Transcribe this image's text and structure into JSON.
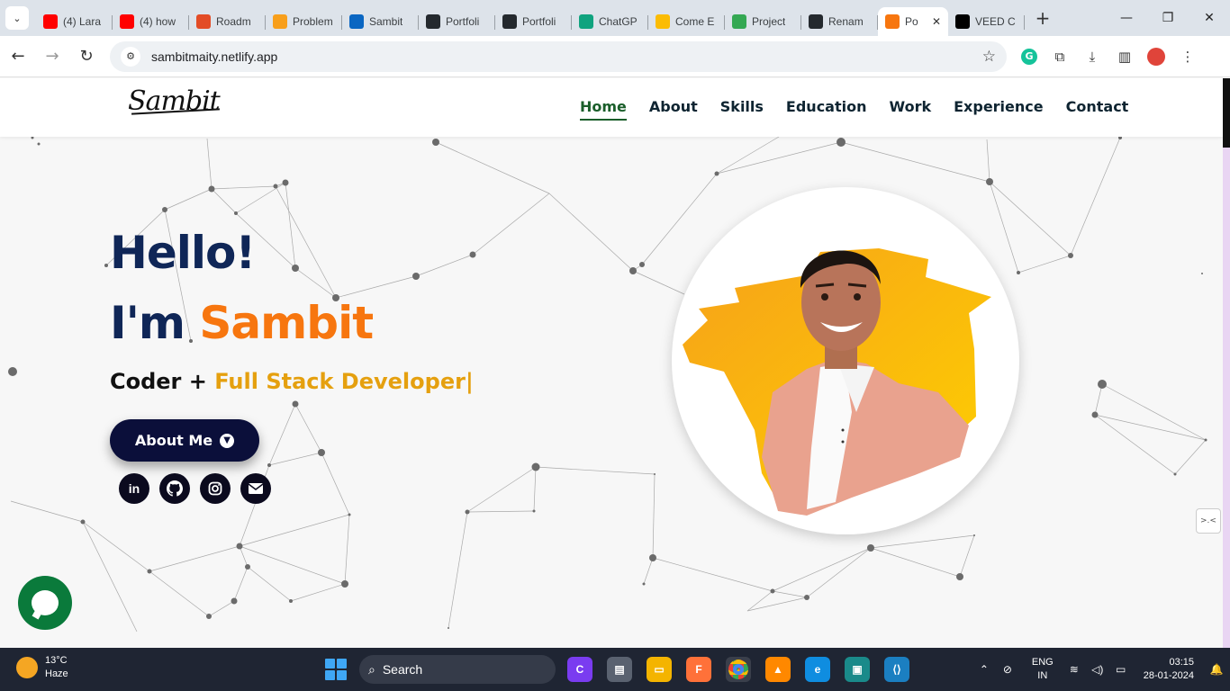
{
  "browser": {
    "tabs": [
      {
        "title": "(4) Lara",
        "icon": "youtube-icon",
        "color": "#ff0000"
      },
      {
        "title": "(4) how",
        "icon": "youtube-icon",
        "color": "#ff0000"
      },
      {
        "title": "Roadm",
        "icon": "rocket-icon",
        "color": "#e34c26"
      },
      {
        "title": "Problem",
        "icon": "leetcode-icon",
        "color": "#f89f1b"
      },
      {
        "title": "Sambit",
        "icon": "linkedin-icon",
        "color": "#0a66c2"
      },
      {
        "title": "Portfoli",
        "icon": "github-icon",
        "color": "#24292e"
      },
      {
        "title": "Portfoli",
        "icon": "github-icon",
        "color": "#24292e"
      },
      {
        "title": "ChatGP",
        "icon": "chatgpt-icon",
        "color": "#10a37f"
      },
      {
        "title": "Come E",
        "icon": "drive-icon",
        "color": "#fbbc04"
      },
      {
        "title": "Project",
        "icon": "drive-icon",
        "color": "#34a853"
      },
      {
        "title": "Renam",
        "icon": "github-icon",
        "color": "#24292e"
      },
      {
        "title": "Po",
        "icon": "portfolio-icon",
        "color": "#f7760f",
        "active": true
      },
      {
        "title": "VEED C",
        "icon": "veed-icon",
        "color": "#000000"
      }
    ],
    "url": "sambitmaity.netlify.app"
  },
  "site": {
    "logo": "Sambit",
    "nav": [
      "Home",
      "About",
      "Skills",
      "Education",
      "Work",
      "Experience",
      "Contact"
    ],
    "active_nav": "Home",
    "hero": {
      "hello": "Hello!",
      "im_prefix": "I'm ",
      "name": "Sambit",
      "role_prefix": "Coder + ",
      "role_typed": "Full Stack Developer",
      "cursor": "|",
      "button": "About Me"
    },
    "socials": [
      "linkedin-icon",
      "github-icon",
      "instagram-icon",
      "mail-icon"
    ]
  },
  "taskbar": {
    "temperature": "13°C",
    "condition": "Haze",
    "search_label": "Search",
    "lang_line1": "ENG",
    "lang_line2": "IN",
    "time": "03:15",
    "date": "28-01-2024"
  }
}
